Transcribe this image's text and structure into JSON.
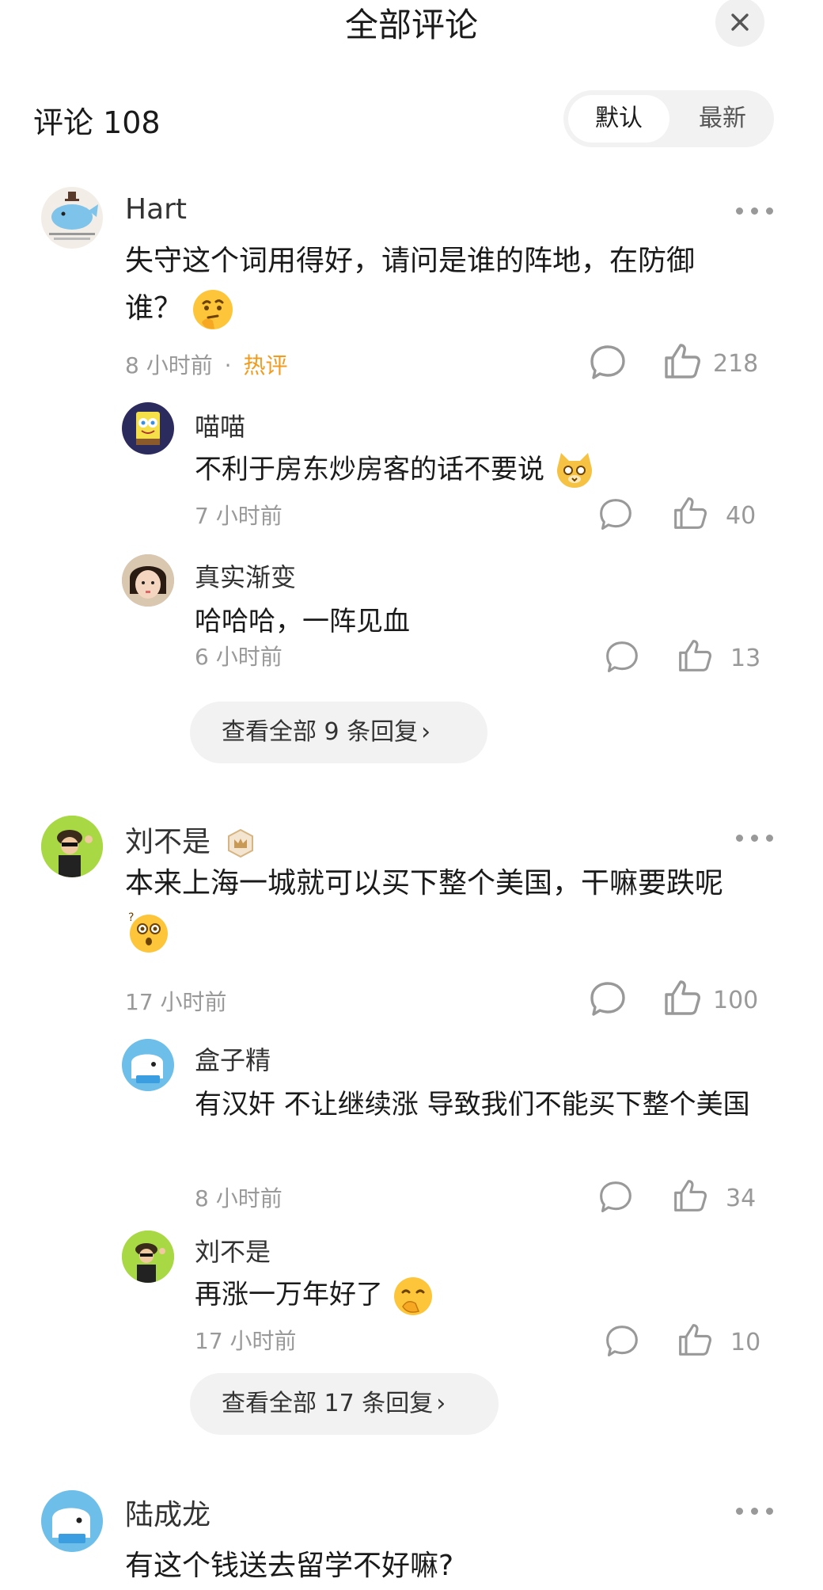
{
  "header": {
    "title": "全部评论"
  },
  "comment_count": "评论 108",
  "sort": {
    "default": "默认",
    "latest": "最新"
  },
  "comments": [
    {
      "name": "Hart",
      "text": "失守这个词用得好，请问是谁的阵地，在防御谁？",
      "time": "8 小时前",
      "dot": "·",
      "tag": "热评",
      "likes": "218",
      "replies": [
        {
          "name": "喵喵",
          "text": "不利于房东炒房客的话不要说",
          "time": "7 小时前",
          "likes": "40"
        },
        {
          "name": "真实渐变",
          "text": "哈哈哈，一阵见血",
          "time": "6 小时前",
          "likes": "13"
        }
      ],
      "view_all": "查看全部 9 条回复"
    },
    {
      "name": "刘不是",
      "text": "本来上海一城就可以买下整个美国，干嘛要跌呢",
      "time": "17 小时前",
      "likes": "100",
      "replies": [
        {
          "name": "盒子精",
          "text": "有汉奸 不让继续涨 导致我们不能买下整个美国",
          "time": "8 小时前",
          "likes": "34"
        },
        {
          "name": "刘不是",
          "text": "再涨一万年好了",
          "time": "17 小时前",
          "likes": "10"
        }
      ],
      "view_all": "查看全部 17 条回复"
    },
    {
      "name": "陆成龙",
      "text": "有这个钱送去留学不好嘛?"
    }
  ],
  "colors": {
    "hot_tag": "#f29b1d",
    "meta_gray": "#999999",
    "pill_bg": "#f2f2f2"
  }
}
